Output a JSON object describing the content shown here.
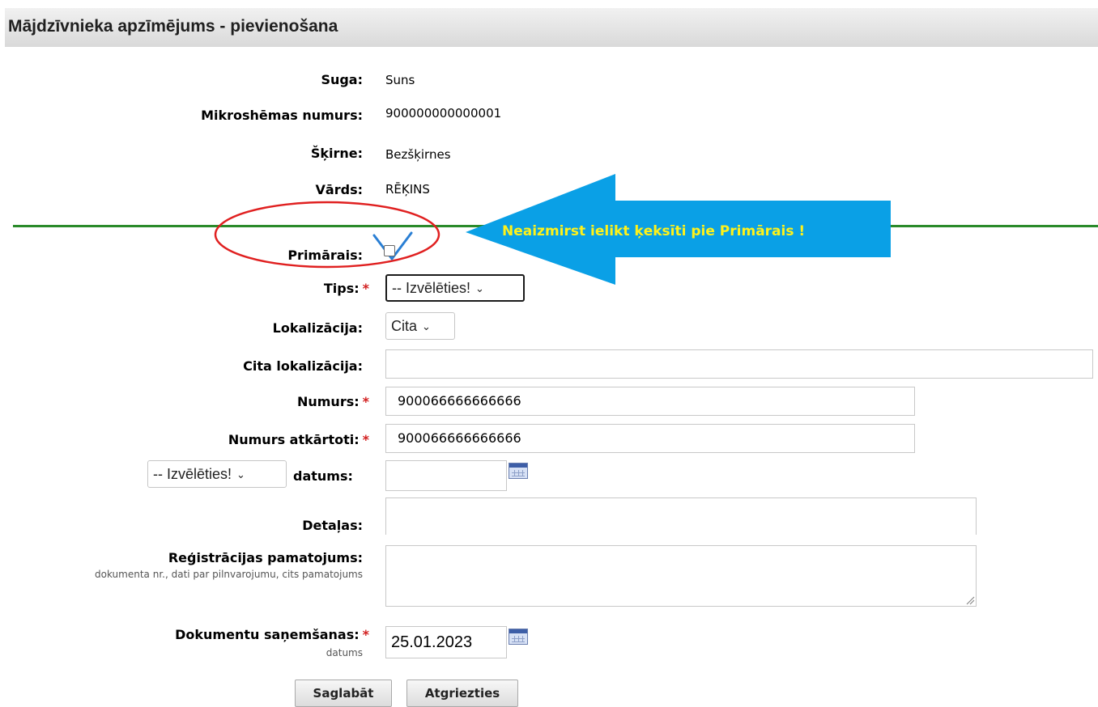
{
  "title": "Mājdzīvnieka apzīmējums - pievienošana",
  "info": {
    "species_label": "Suga:",
    "species_value": "Suns",
    "chip_label": "Mikroshēmas numurs:",
    "chip_value": "900000000000001",
    "breed_label": "Šķirne:",
    "breed_value": "Bezšķirnes",
    "name_label": "Vārds:",
    "name_value": "RĒĶINS"
  },
  "annotation": {
    "arrow_text": "Neaizmirst ielikt ķeksīti pie Primārais !",
    "arrow_color": "#0aa0e6",
    "arrow_text_color": "#fff21a",
    "circle_color": "#e02020",
    "check_color": "#2a7fd4"
  },
  "form": {
    "primary_label": "Primārais:",
    "type_label": "Tips:",
    "type_value": "-- Izvēlēties!",
    "location_label": "Lokalizācija:",
    "location_value": "Cita",
    "other_location_label": "Cita lokalizācija:",
    "other_location_value": "",
    "number_label": "Numurs:",
    "number_value": "900066666666666",
    "number_repeat_label": "Numurs atkārtoti:",
    "number_repeat_value": "900066666666666",
    "date_type_value": "-- Izvēlēties!",
    "date_label": "datums:",
    "date_value": "",
    "details_label": "Detaļas:",
    "details_value": "",
    "reg_basis_label": "Reģistrācijas pamatojums:",
    "reg_basis_hint": "dokumenta nr., dati par pilnvarojumu, cits pamatojums",
    "reg_basis_value": "",
    "doc_received_label": "Dokumentu saņemšanas:",
    "doc_received_hint": "datums",
    "doc_received_value": "25.01.2023",
    "required_mark": "*"
  },
  "buttons": {
    "save": "Saglabāt",
    "back": "Atgriezties"
  },
  "colors": {
    "divider": "#2a8a2a",
    "required": "#d21f1f"
  }
}
